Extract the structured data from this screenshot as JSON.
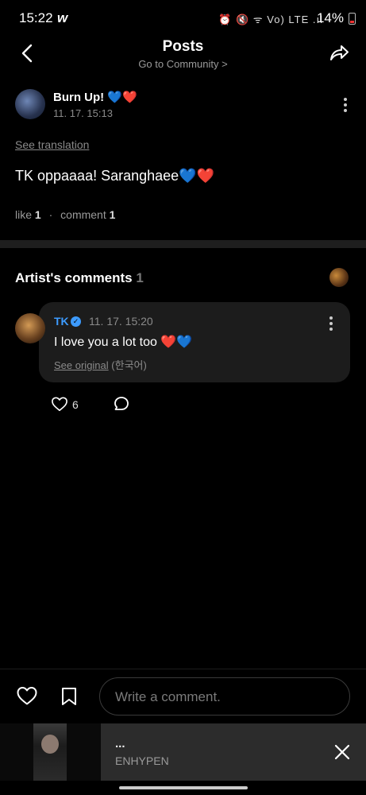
{
  "status": {
    "time": "15:22",
    "app_glyph": "w",
    "icons": "⏰ 🔇 ᯤ Vo) LTE .ıl",
    "battery": "14%"
  },
  "header": {
    "title": "Posts",
    "subtitle": "Go to Community >"
  },
  "post": {
    "author": "Burn Up! 💙❤️",
    "time": "11. 17. 15:13",
    "see_translation": "See translation",
    "body": "TK oppaaaa! Saranghaee💙❤️",
    "like_label": "like",
    "like_count": "1",
    "comment_label": "comment",
    "comment_count": "1",
    "separator": "·"
  },
  "artist_comments": {
    "title": "Artist's comments",
    "count": "1",
    "comment": {
      "name": "TK",
      "time": "11. 17. 15:20",
      "text": "I love you a lot too ❤️💙",
      "see_original": "See original",
      "original_lang": "(한국어)",
      "likes": "6"
    }
  },
  "composer": {
    "placeholder": "Write a comment."
  },
  "mini_player": {
    "title": "...",
    "artist": "ENHYPEN"
  },
  "colors": {
    "accent": "#3d9bff",
    "background": "#000000"
  }
}
